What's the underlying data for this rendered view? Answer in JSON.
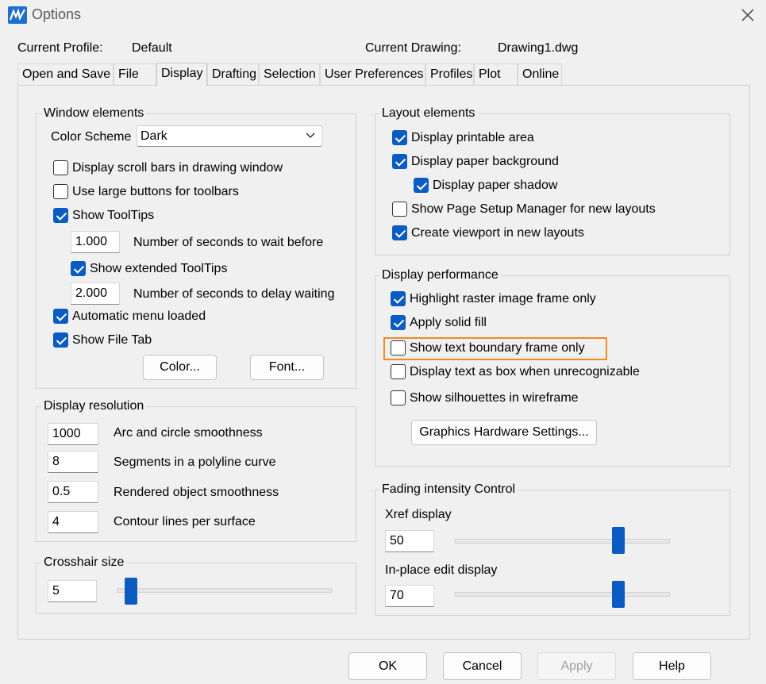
{
  "window": {
    "title": "Options"
  },
  "header": {
    "profile_label": "Current Profile:",
    "profile_value": "Default",
    "drawing_label": "Current Drawing:",
    "drawing_value": "Drawing1.dwg"
  },
  "tabs": [
    {
      "label": "Open and Save"
    },
    {
      "label": "File"
    },
    {
      "label": "Display",
      "active": true
    },
    {
      "label": "Drafting"
    },
    {
      "label": "Selection"
    },
    {
      "label": "User Preferences"
    },
    {
      "label": "Profiles"
    },
    {
      "label": "Plot"
    },
    {
      "label": "Online"
    }
  ],
  "window_elements": {
    "title": "Window elements",
    "color_scheme_label": "Color Scheme",
    "color_scheme_value": "Dark",
    "scroll_bars": {
      "label": "Display scroll bars in drawing window",
      "checked": false
    },
    "large_buttons": {
      "label": "Use large buttons for toolbars",
      "checked": false
    },
    "show_tooltips": {
      "label": "Show ToolTips",
      "checked": true
    },
    "tooltip_wait_value": "1.000",
    "tooltip_wait_label": "Number of seconds to wait before",
    "extended_tooltips": {
      "label": "Show extended ToolTips",
      "checked": true
    },
    "extended_delay_value": "2.000",
    "extended_delay_label": "Number of seconds to delay waiting",
    "auto_menu": {
      "label": "Automatic menu loaded",
      "checked": true
    },
    "file_tab": {
      "label": "Show File Tab",
      "checked": true
    },
    "color_button": "Color...",
    "font_button": "Font..."
  },
  "display_resolution": {
    "title": "Display resolution",
    "rows": [
      {
        "value": "1000",
        "label": "Arc and circle smoothness"
      },
      {
        "value": "8",
        "label": "Segments in a polyline curve"
      },
      {
        "value": "0.5",
        "label": "Rendered object smoothness"
      },
      {
        "value": "4",
        "label": "Contour lines per surface"
      }
    ]
  },
  "crosshair": {
    "title": "Crosshair size",
    "value": "5",
    "slider_fraction": 0.05
  },
  "layout_elements": {
    "title": "Layout elements",
    "items": [
      {
        "label": "Display printable area",
        "checked": true
      },
      {
        "label": "Display paper background",
        "checked": true
      },
      {
        "label": "Display paper shadow",
        "checked": true
      },
      {
        "label": "Show Page Setup Manager for new layouts",
        "checked": false
      },
      {
        "label": "Create viewport in new layouts",
        "checked": true
      }
    ]
  },
  "display_performance": {
    "title": "Display performance",
    "items": [
      {
        "label": "Highlight raster image frame only",
        "checked": true
      },
      {
        "label": "Apply solid fill",
        "checked": true
      },
      {
        "label": "Show text boundary frame only",
        "checked": false
      },
      {
        "label": "Display text as box when unrecognizable",
        "checked": false
      },
      {
        "label": "Show silhouettes in wireframe",
        "checked": false
      }
    ],
    "graphics_button": "Graphics Hardware Settings...",
    "highlight_color": "#f08a24"
  },
  "fading": {
    "title": "Fading intensity Control",
    "xref_label": "Xref display",
    "xref_value": "50",
    "inplace_label": "In-place edit display",
    "inplace_value": "70"
  },
  "footer": {
    "ok": "OK",
    "cancel": "Cancel",
    "apply": "Apply",
    "help": "Help"
  },
  "colors": {
    "accent": "#0a5bc2",
    "background": "#f0f0f0"
  }
}
